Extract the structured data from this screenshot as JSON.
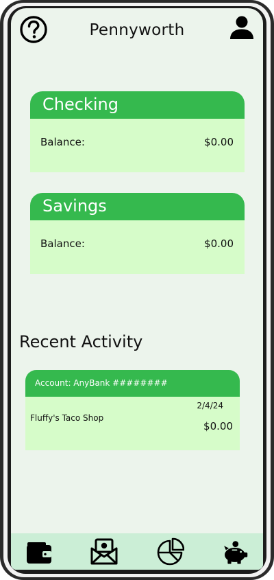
{
  "header": {
    "title": "Pennyworth",
    "help_icon": "question-circle-icon",
    "profile_icon": "user-icon"
  },
  "accounts": [
    {
      "name": "Checking",
      "balance_label": "Balance:",
      "balance": "$0.00"
    },
    {
      "name": "Savings",
      "balance_label": "Balance:",
      "balance": "$0.00"
    }
  ],
  "recent_activity": {
    "title": "Recent Activity",
    "transactions": [
      {
        "account": "Account: AnyBank ########",
        "date": "2/4/24",
        "merchant": "Fluffy's Taco Shop",
        "amount": "$0.00"
      }
    ]
  },
  "bottom_nav": {
    "items": [
      {
        "icon": "wallet-icon"
      },
      {
        "icon": "envelope-money-icon"
      },
      {
        "icon": "pie-chart-icon"
      },
      {
        "icon": "piggy-bank-icon"
      }
    ]
  },
  "colors": {
    "accent": "#35b94e",
    "card_body": "#d6fcc9",
    "screen_bg": "#ecf4ec",
    "nav_bg": "#cbeed6"
  }
}
